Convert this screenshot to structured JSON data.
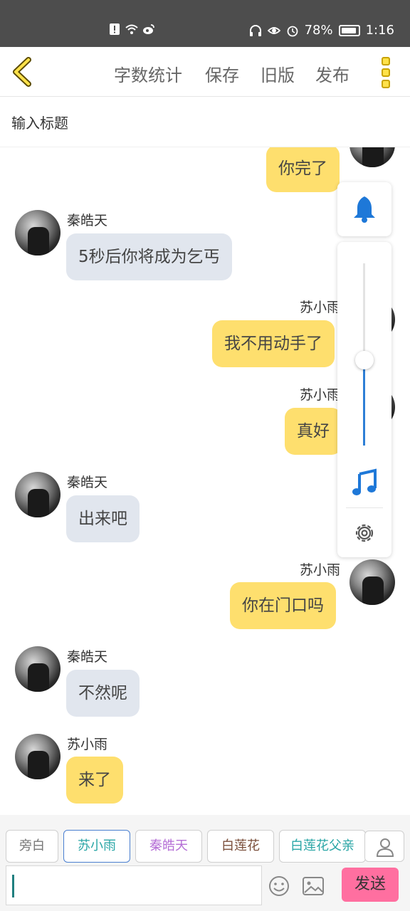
{
  "status_bar": {
    "battery": "78%",
    "time": "1:16"
  },
  "nav": {
    "word_count": "字数统计",
    "save": "保存",
    "old_version": "旧版",
    "publish": "发布"
  },
  "title_placeholder": "输入标题",
  "messages": [
    {
      "sender": "",
      "text": "你完了",
      "side": "right"
    },
    {
      "sender": "秦皓天",
      "text": "5秒后你将成为乞丐",
      "side": "left"
    },
    {
      "sender": "苏小雨",
      "text": "我不用动手了",
      "side": "right"
    },
    {
      "sender": "苏小雨",
      "text": "真好",
      "side": "right"
    },
    {
      "sender": "秦皓天",
      "text": "出来吧",
      "side": "left"
    },
    {
      "sender": "苏小雨",
      "text": "你在门口吗",
      "side": "right"
    },
    {
      "sender": "秦皓天",
      "text": "不然呢",
      "side": "left"
    },
    {
      "sender": "苏小雨",
      "text": "来了",
      "side": "left"
    }
  ],
  "float_panel": {
    "volume_level": 0.47
  },
  "role_chips": [
    {
      "label": "旁白",
      "color": "#777777"
    },
    {
      "label": "苏小雨",
      "color": "#2aa6a6"
    },
    {
      "label": "秦皓天",
      "color": "#b56ed6"
    },
    {
      "label": "白莲花",
      "color": "#7a4e3a"
    },
    {
      "label": "白莲花父亲",
      "color": "#2aa6a6"
    }
  ],
  "send_label": "发送",
  "colors": {
    "me_bubble": "#fedf6e",
    "other_bubble": "#e1e6ee",
    "accent": "#2e7fd6",
    "send": "#ff6fa0"
  }
}
